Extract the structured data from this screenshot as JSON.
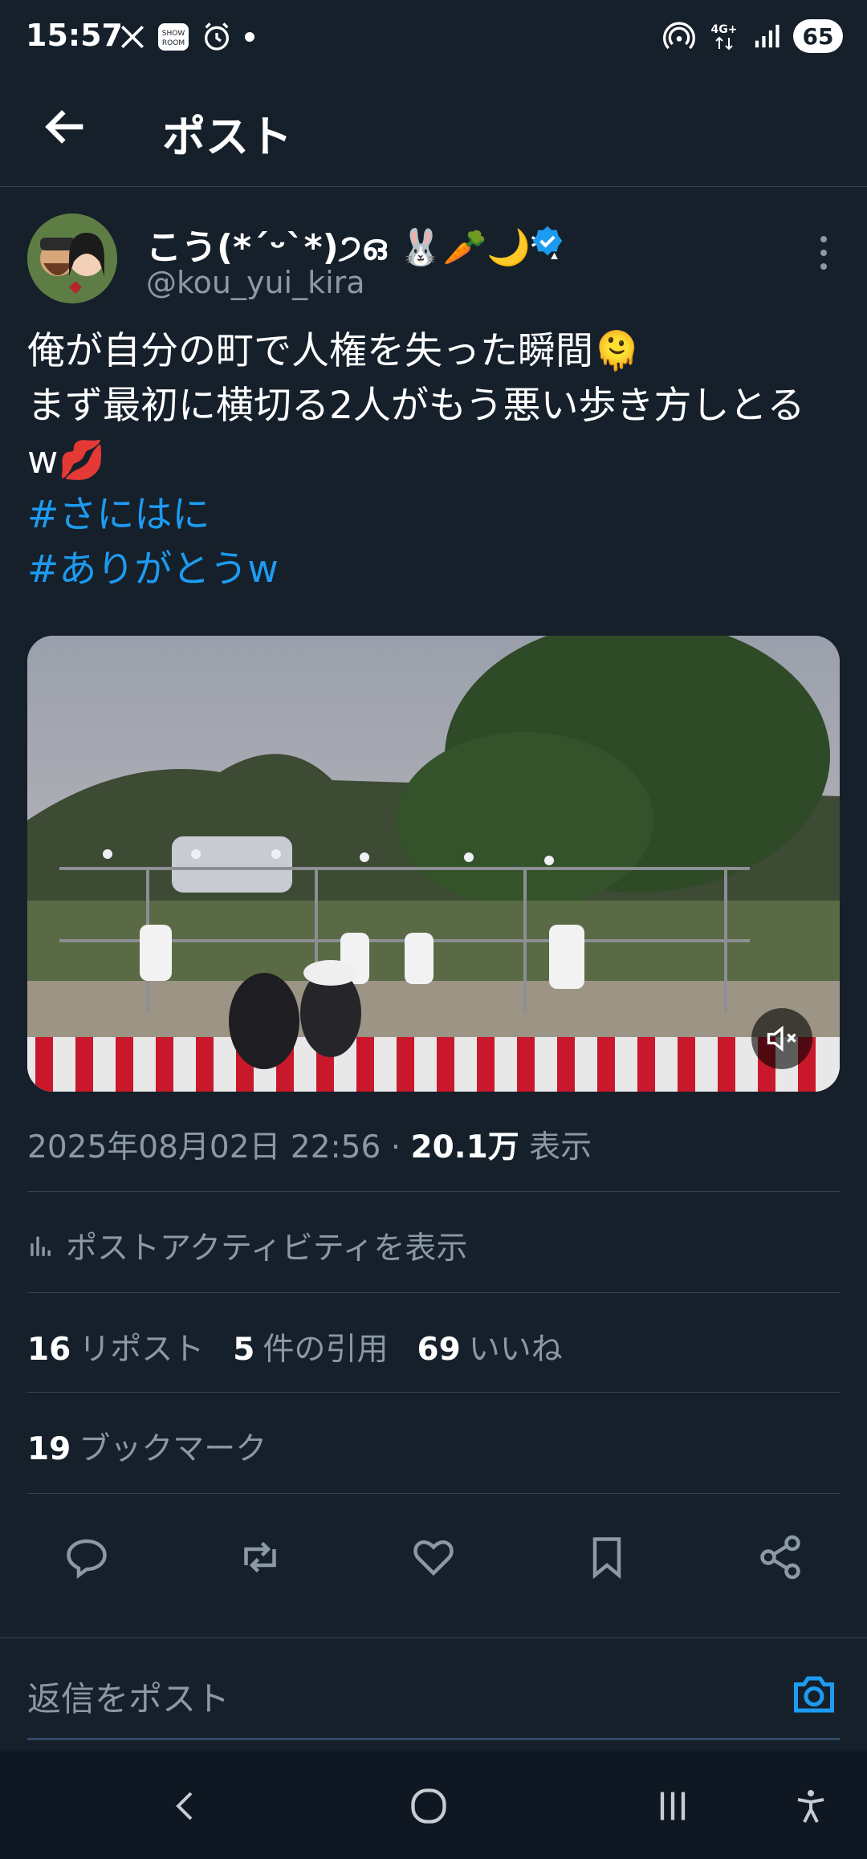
{
  "status": {
    "time": "15:57",
    "network": "4G+",
    "battery": "65",
    "left_icons": [
      "x-icon",
      "showroom-icon",
      "alarm-icon",
      "dot-icon"
    ],
    "right_icons": [
      "hotspot-icon",
      "network-4g-icon",
      "signal-icon",
      "battery-icon"
    ]
  },
  "header": {
    "title": "ポスト"
  },
  "post": {
    "display_name": "こう(*´ᵕ`*)੭ഒ 🐰🥕🌙*ː",
    "handle": "@kou_yui_kira",
    "text_lines": [
      "俺が自分の町で人権を失った瞬間🫠",
      "まず最初に横切る2人がもう悪い歩き方しとる",
      "w💋"
    ],
    "hashtags": [
      "#さにはに",
      "#ありがとうw"
    ],
    "timestamp": "2025年08月02日 22:56",
    "separator": "·",
    "views_count": "20.1万",
    "views_label": "表示",
    "activity_label": "ポストアクティビティを表示",
    "reposts_count": "16",
    "reposts_label": "リポスト",
    "quotes_count": "5",
    "quotes_label": "件の引用",
    "likes_count": "69",
    "likes_label": "いいね",
    "bookmarks_count": "19",
    "bookmarks_label": "ブックマーク"
  },
  "reply": {
    "placeholder": "返信をポスト"
  },
  "colors": {
    "background": "#15202b",
    "accent": "#1d9bf0",
    "muted": "#8b98a5",
    "divider": "#38444d"
  }
}
